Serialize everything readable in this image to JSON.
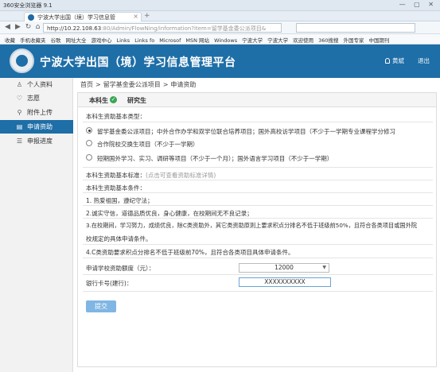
{
  "browser": {
    "window_title": "360安全浏览器 9.1",
    "tab_title": "宁波大学出国（境）学习信息管",
    "url_host": "http://10.22.108.63",
    "url_path": ":80/Admin/FlowNing/information?item=留学基金委公派项目&",
    "bookmarks": [
      "收藏",
      "手机收藏夹",
      "谷歌",
      "网址大全",
      "游戏中心",
      "Links",
      "Links fo",
      "Microsof",
      "MSN 网站",
      "Windows",
      "宁波大学",
      "宁波大学",
      "欢迎使用",
      "360搜搜",
      "外国专家",
      "中国期刊"
    ]
  },
  "header": {
    "site_title": "宁波大学出国（境）学习信息管理平台",
    "user_name": "黄斌",
    "logout": "退出"
  },
  "sidebar": {
    "items": [
      {
        "label": "个人资料",
        "icon": "person-icon"
      },
      {
        "label": "志愿",
        "icon": "heart-icon"
      },
      {
        "label": "附件上传",
        "icon": "attachment-icon"
      },
      {
        "label": "申请资助",
        "icon": "document-icon"
      },
      {
        "label": "申报进度",
        "icon": "progress-icon"
      }
    ],
    "active_index": 3
  },
  "breadcrumb": [
    "首页",
    "留学基金委公派项目",
    "申请资助"
  ],
  "tabs": {
    "undergrad": "本科生",
    "graduate": "研究生"
  },
  "form": {
    "types_heading": "本科生资助基本类型：",
    "options": [
      "留学基金委公派项目；中外合作办学和双学位联合培养项目；国外高校访学项目（不少于一学期专业课程学分修习",
      "合作院校交换生项目（不少于一学期）",
      "短期国外学习、实习、调研等项目（不少于一个月）；国外语言学习项目（不少于一学期）"
    ],
    "selected_option": 0,
    "standard_label": "本科生资助基本标准：",
    "standard_link": "(点击可查看资助标准详情)",
    "conditions_heading": "本科生资助基本条件：",
    "conditions": [
      "1. 热爱祖国，遵纪守法；",
      "2.诚实守信，道德品质优良，身心健康，在校期间无不良记录；",
      "3.在校期间，学习努力，成绩优良，除C类资助外，其它类资助原则上要求积点分排名不低于班级前50%，且符合各类项目或国外院",
      "校规定的具体申请条件。",
      "4.C类资助要求积点分排名不低于班级前70%，且符合各类项目具体申请条件。"
    ],
    "amount_label": "申请学校资助额度（元）：",
    "amount_value": "12000",
    "card_label": "银行卡号(建行)：",
    "card_value": "XXXXXXXXXX",
    "submit_label": "提交"
  }
}
